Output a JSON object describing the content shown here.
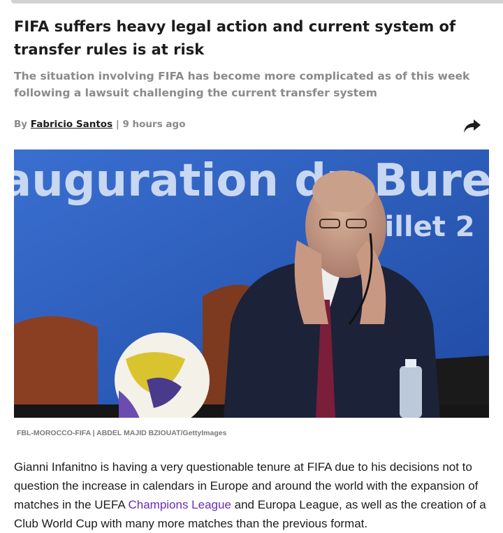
{
  "article": {
    "title": "FIFA suffers heavy legal action and current system of transfer rules is at risk",
    "subtitle": "The situation involving FIFA has become more complicated as of this week following a lawsuit challenging the current transfer system",
    "byline": {
      "prefix": "By",
      "author": "Fabricio Santos",
      "separator": "|",
      "time": "9 hours ago"
    },
    "share_icon": "share-arrow-icon",
    "image": {
      "banner_line1": "auguration du Bure",
      "banner_line2": "uillet 2"
    },
    "caption": "FBL-MOROCCO-FIFA | ABDEL MAJID BZIOUAT/GettyImages",
    "body": {
      "part1": "Gianni Infanitno is having a very questionable tenure at FIFA due to his decisions not to question the increase in calendars in Europe and around the world with the expansion of matches in the UEFA ",
      "link": "Champions League",
      "part2": " and Europa League, as well as the creation of a Club World Cup with many more matches than the previous format."
    }
  },
  "colors": {
    "title": "#1c1c1c",
    "subtitle": "#8a8a8a",
    "link": "#6a2bb5",
    "photo_background": "#2a5ab8"
  }
}
